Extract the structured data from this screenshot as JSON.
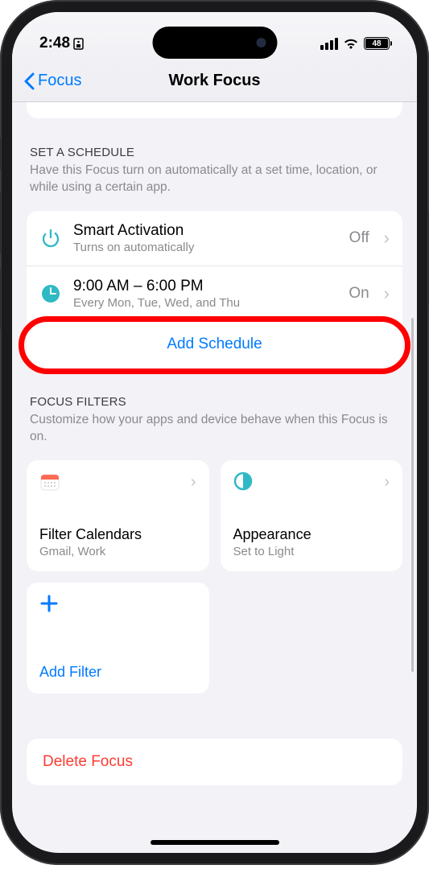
{
  "status": {
    "time": "2:48",
    "battery": "48"
  },
  "nav": {
    "back": "Focus",
    "title": "Work Focus"
  },
  "schedule": {
    "header": "SET A SCHEDULE",
    "desc": "Have this Focus turn on automatically at a set time, location, or while using a certain app.",
    "smart": {
      "title": "Smart Activation",
      "sub": "Turns on automatically",
      "value": "Off"
    },
    "time": {
      "title": "9:00 AM – 6:00 PM",
      "sub": "Every Mon, Tue, Wed, and Thu",
      "value": "On"
    },
    "add": "Add Schedule"
  },
  "filters": {
    "header": "FOCUS FILTERS",
    "desc": "Customize how your apps and device behave when this Focus is on.",
    "calendar": {
      "title": "Filter Calendars",
      "sub": "Gmail, Work"
    },
    "appearance": {
      "title": "Appearance",
      "sub": "Set to Light"
    },
    "add": "Add Filter"
  },
  "delete": "Delete Focus"
}
